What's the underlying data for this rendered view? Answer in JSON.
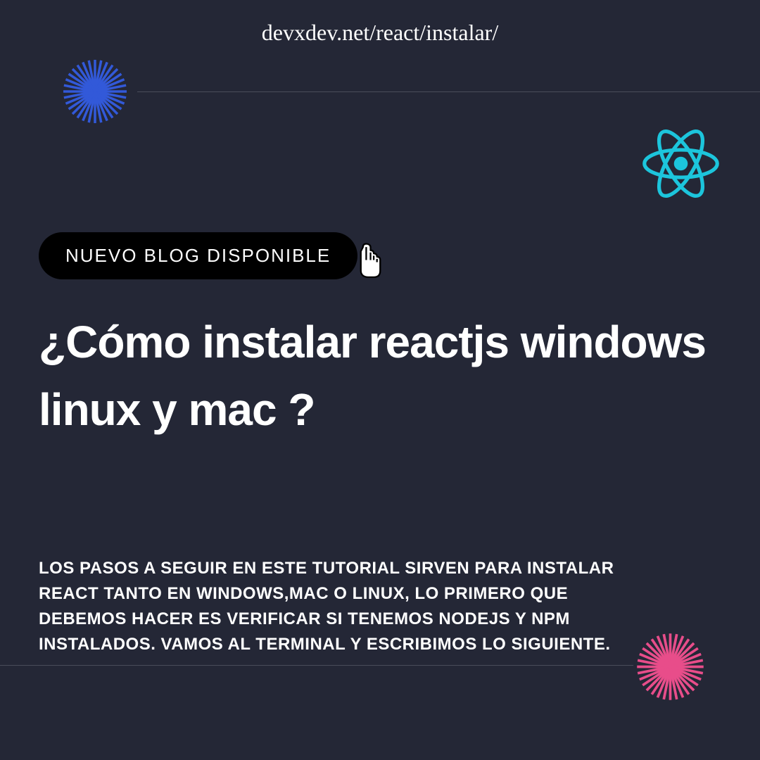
{
  "url": "devxdev.net/react/instalar/",
  "badge": "NUEVO BLOG DISPONIBLE",
  "headline": "¿Cómo instalar reactjs windows linux y mac ?",
  "description": "LOS PASOS A SEGUIR EN ESTE TUTORIAL SIRVEN PARA INSTALAR REACT TANTO EN WINDOWS,MAC O LINUX, LO PRIMERO QUE DEBEMOS HACER ES VERIFICAR SI TENEMOS NODEJS Y NPM INSTALADOS. VAMOS AL TERMINAL Y ESCRIBIMOS LO SIGUIENTE.",
  "colors": {
    "background": "#242736",
    "text": "#ffffff",
    "badge_bg": "#000000",
    "blue_accent": "#3259d9",
    "cyan_accent": "#1CC5DC",
    "pink_accent": "#E84D8A",
    "divider": "#4a4d5a"
  }
}
